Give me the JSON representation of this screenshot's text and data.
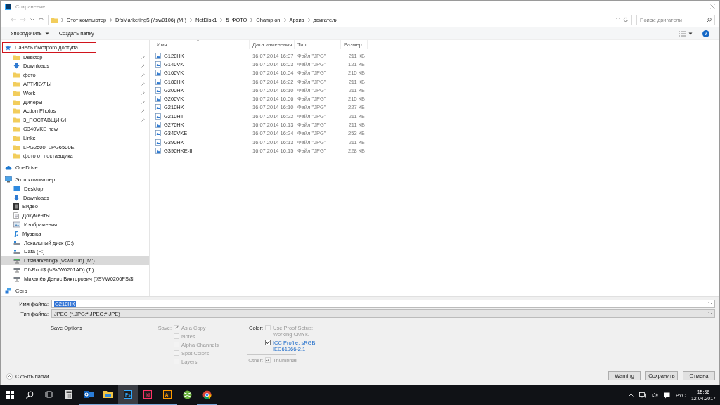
{
  "window": {
    "title": "Сохранение"
  },
  "address": {
    "crumbs": [
      "Этот компьютер",
      "DfsMarketing$ (\\\\sw0106) (M:)",
      "NetDisk1",
      "5_ФОТО",
      "Champion",
      "Архив",
      "двигатели"
    ],
    "search_placeholder": "Поиск: двигатели"
  },
  "toolbar": {
    "organize": "Упорядочить",
    "new_folder": "Создать папку",
    "help": "?"
  },
  "nav": [
    {
      "label": "Панель быстрого доступа",
      "kind": "star",
      "selected": false,
      "annotated": true,
      "children": [
        {
          "label": "Desktop",
          "kind": "folder",
          "pinned": true,
          "selected": false
        },
        {
          "label": "Downloads",
          "kind": "download",
          "pinned": true,
          "selected": false
        },
        {
          "label": "фото",
          "kind": "folder",
          "pinned": true,
          "selected": false
        },
        {
          "label": "АРТИКУЛЫ",
          "kind": "folder",
          "pinned": true,
          "selected": false
        },
        {
          "label": "Work",
          "kind": "folder",
          "pinned": true,
          "selected": false
        },
        {
          "label": "Дилеры",
          "kind": "folder",
          "pinned": true,
          "selected": false
        },
        {
          "label": "Action Photos",
          "kind": "folder",
          "pinned": true,
          "selected": false
        },
        {
          "label": "3_ПОСТАВЩИКИ",
          "kind": "folder",
          "pinned": true,
          "selected": false
        },
        {
          "label": "G340VKE new",
          "kind": "folder",
          "pinned": false,
          "selected": false
        },
        {
          "label": "Links",
          "kind": "folder",
          "pinned": false,
          "selected": false
        },
        {
          "label": "LPG2500_LPG6500E",
          "kind": "folder",
          "pinned": false,
          "selected": false
        },
        {
          "label": "фото от поставщика",
          "kind": "folder",
          "pinned": false,
          "selected": false
        }
      ]
    },
    {
      "label": "OneDrive",
      "kind": "cloud",
      "selected": false
    },
    {
      "label": "Этот компьютер",
      "kind": "computer",
      "selected": false,
      "children": [
        {
          "label": "Desktop",
          "kind": "desktop",
          "selected": false
        },
        {
          "label": "Downloads",
          "kind": "download",
          "selected": false
        },
        {
          "label": "Видео",
          "kind": "video",
          "selected": false
        },
        {
          "label": "Документы",
          "kind": "document",
          "selected": false
        },
        {
          "label": "Изображения",
          "kind": "image",
          "selected": false
        },
        {
          "label": "Музыка",
          "kind": "music",
          "selected": false
        },
        {
          "label": "Локальный диск (C:)",
          "kind": "drive",
          "selected": false
        },
        {
          "label": "Data (F:)",
          "kind": "drive",
          "selected": false
        },
        {
          "label": "DfsMarketing$ (\\\\sw0106) (M:)",
          "kind": "netdrive",
          "selected": true
        },
        {
          "label": "DfsRoot$ (\\\\SVW0201AD) (T:)",
          "kind": "netdrive",
          "selected": false
        },
        {
          "label": "Михалёв Денис Викторович (\\\\SVW0206FS\\$I",
          "kind": "netdrive",
          "selected": false
        }
      ]
    },
    {
      "label": "Сеть",
      "kind": "network",
      "selected": false
    }
  ],
  "files": {
    "columns": [
      "Имя",
      "Дата изменения",
      "Тип",
      "Размер"
    ],
    "rows": [
      {
        "name": "G120HK",
        "date": "16.07.2014 16:07",
        "type": "Файл \"JPG\"",
        "size": "211 КБ"
      },
      {
        "name": "G140VK",
        "date": "16.07.2014 16:03",
        "type": "Файл \"JPG\"",
        "size": "121 КБ"
      },
      {
        "name": "G160VK",
        "date": "16.07.2014 16:04",
        "type": "Файл \"JPG\"",
        "size": "215 КБ"
      },
      {
        "name": "G180HK",
        "date": "16.07.2014 16:22",
        "type": "Файл \"JPG\"",
        "size": "211 КБ"
      },
      {
        "name": "G200HK",
        "date": "16.07.2014 16:10",
        "type": "Файл \"JPG\"",
        "size": "211 КБ"
      },
      {
        "name": "G200VK",
        "date": "16.07.2014 16:06",
        "type": "Файл \"JPG\"",
        "size": "215 КБ"
      },
      {
        "name": "G210HK",
        "date": "16.07.2014 16:10",
        "type": "Файл \"JPG\"",
        "size": "227 КБ"
      },
      {
        "name": "G210HT",
        "date": "16.07.2014 16:22",
        "type": "Файл \"JPG\"",
        "size": "211 КБ"
      },
      {
        "name": "G270HK",
        "date": "16.07.2014 16:13",
        "type": "Файл \"JPG\"",
        "size": "211 КБ"
      },
      {
        "name": "G340VKE",
        "date": "16.07.2014 16:24",
        "type": "Файл \"JPG\"",
        "size": "253 КБ"
      },
      {
        "name": "G390HK",
        "date": "16.07.2014 16:13",
        "type": "Файл \"JPG\"",
        "size": "211 КБ"
      },
      {
        "name": "G390HKE-II",
        "date": "16.07.2014 16:15",
        "type": "Файл \"JPG\"",
        "size": "228 КБ"
      }
    ]
  },
  "file_name": {
    "label": "Имя файла:",
    "value": "G210HK",
    "highlighted": true
  },
  "file_type": {
    "label": "Тип файла:",
    "value": "JPEG (*.JPG;*.JPEG;*.JPE)"
  },
  "save_options": {
    "title": "Save Options",
    "groups": [
      {
        "label": "Save:",
        "disabled": true,
        "items": [
          {
            "label": "As a Copy",
            "checked": true,
            "disabled": true
          },
          {
            "label": "Notes",
            "checked": false,
            "disabled": true
          },
          {
            "label": "Alpha Channels",
            "checked": false,
            "disabled": true
          },
          {
            "label": "Spot Colors",
            "checked": false,
            "disabled": true
          },
          {
            "label": "Layers",
            "checked": false,
            "disabled": true
          }
        ]
      },
      {
        "label": "Color:",
        "disabled": false,
        "items": [
          {
            "label": "Use Proof Setup:",
            "sub": "Working CMYK",
            "checked": false,
            "disabled": true
          },
          {
            "label": "ICC Profile: sRGB",
            "sub": "IEC61966-2.1",
            "checked": true,
            "disabled": false
          }
        ],
        "other": {
          "label": "Other:",
          "items": [
            {
              "label": "Thumbnail",
              "checked": true,
              "disabled": true
            }
          ]
        }
      }
    ]
  },
  "hide_folders": "Скрыть папки",
  "buttons": [
    "Warning",
    "Сохранить",
    "Отмена"
  ],
  "taskbar": {
    "apps": [
      {
        "kind": "calculator",
        "running": false,
        "selected": false
      },
      {
        "kind": "outlook",
        "running": true,
        "selected": false
      },
      {
        "kind": "explorer",
        "running": true,
        "selected": false
      },
      {
        "kind": "tile",
        "label": "Ps",
        "color": "#31a8ff",
        "running": true,
        "selected": true
      },
      {
        "kind": "tile",
        "label": "Id",
        "color": "#ff3366",
        "running": true,
        "selected": false
      },
      {
        "kind": "tile",
        "label": "Ai",
        "color": "#ff9a00",
        "running": true,
        "selected": false
      },
      {
        "kind": "ball",
        "running": false,
        "selected": false
      },
      {
        "kind": "browser",
        "running": true,
        "selected": false
      }
    ],
    "language": "РУС",
    "time": "15:56",
    "date": "12.04.2017"
  }
}
